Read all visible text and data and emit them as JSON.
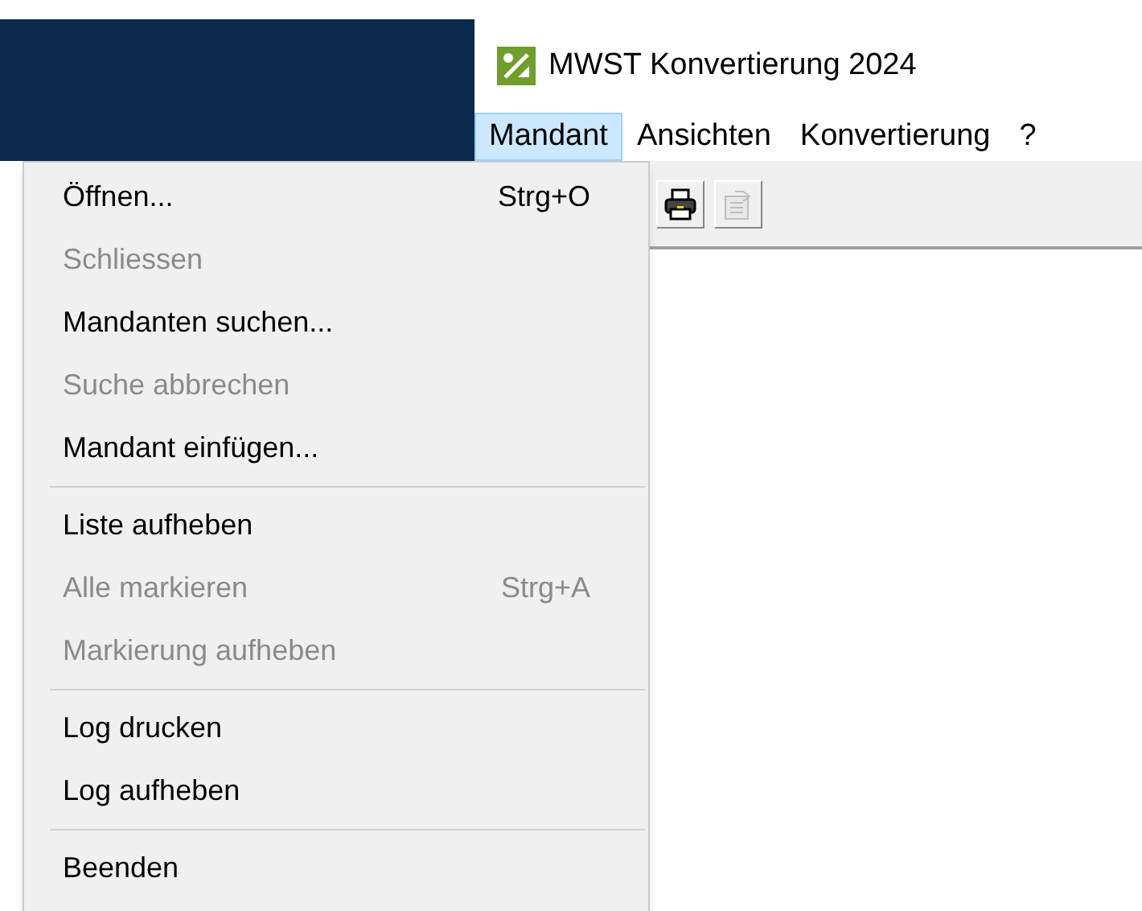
{
  "window": {
    "title": "MWST Konvertierung 2024"
  },
  "menu_bar": [
    {
      "label": "Mandant",
      "selected": true
    },
    {
      "label": "Ansichten",
      "selected": false
    },
    {
      "label": "Konvertierung",
      "selected": false
    },
    {
      "label": "?",
      "selected": false
    }
  ],
  "toolbar": [
    {
      "kind": "print",
      "disabled": false
    },
    {
      "kind": "properties",
      "disabled": true
    }
  ],
  "dropdown": [
    {
      "kind": "item",
      "label": "Öffnen...",
      "shortcut": "Strg+O",
      "disabled": false
    },
    {
      "kind": "item",
      "label": "Schliessen",
      "disabled": true
    },
    {
      "kind": "item",
      "label": "Mandanten suchen...",
      "disabled": false
    },
    {
      "kind": "item",
      "label": "Suche abbrechen",
      "disabled": true
    },
    {
      "kind": "item",
      "label": "Mandant einfügen...",
      "disabled": false
    },
    {
      "kind": "separator"
    },
    {
      "kind": "item",
      "label": "Liste aufheben",
      "disabled": false
    },
    {
      "kind": "item",
      "label": "Alle markieren",
      "shortcut": "Strg+A",
      "disabled": true
    },
    {
      "kind": "item",
      "label": "Markierung aufheben",
      "disabled": true
    },
    {
      "kind": "separator"
    },
    {
      "kind": "item",
      "label": "Log drucken",
      "disabled": false
    },
    {
      "kind": "item",
      "label": "Log aufheben",
      "disabled": false
    },
    {
      "kind": "separator"
    },
    {
      "kind": "item",
      "label": "Beenden",
      "disabled": false
    }
  ]
}
